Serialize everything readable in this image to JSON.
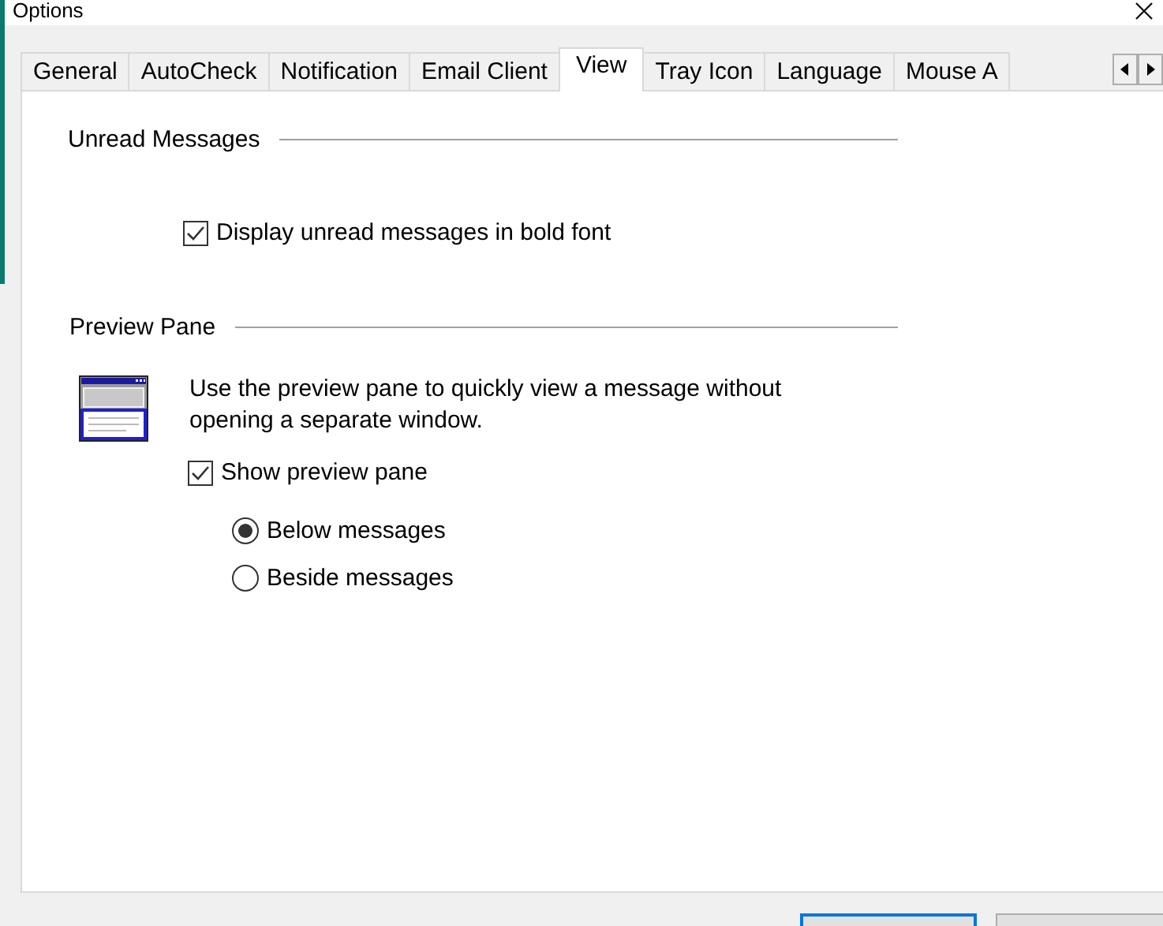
{
  "window": {
    "title": "Options"
  },
  "tabs": [
    {
      "label": "General",
      "selected": false
    },
    {
      "label": "AutoCheck",
      "selected": false
    },
    {
      "label": "Notification",
      "selected": false
    },
    {
      "label": "Email Client",
      "selected": false
    },
    {
      "label": "View",
      "selected": true
    },
    {
      "label": "Tray Icon",
      "selected": false
    },
    {
      "label": "Language",
      "selected": false
    },
    {
      "label": "Mouse A",
      "selected": false
    }
  ],
  "unread_messages": {
    "heading": "Unread Messages",
    "options": [
      {
        "label": "Display unread messages in bold font",
        "checked": true
      }
    ]
  },
  "preview_pane": {
    "heading": "Preview Pane",
    "description": "Use the preview pane to quickly view a message without opening a separate window.",
    "show": {
      "label": "Show preview pane",
      "checked": true
    },
    "positions": [
      {
        "label": "Below messages",
        "selected": true
      },
      {
        "label": "Beside messages",
        "selected": false
      }
    ]
  }
}
